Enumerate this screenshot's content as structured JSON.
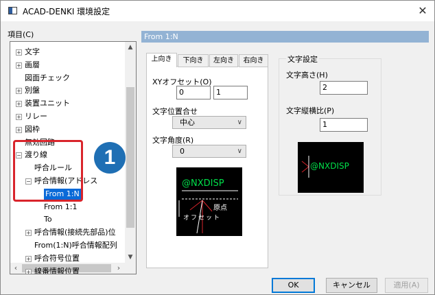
{
  "window": {
    "title": "ACAD-DENKI 環境設定",
    "close_glyph": "✕"
  },
  "items_label": "項目(C)",
  "tree": [
    {
      "label": "文字",
      "toggle": "+"
    },
    {
      "label": "画層",
      "toggle": "+"
    },
    {
      "label": "図面チェック",
      "toggle": ""
    },
    {
      "label": "別盤",
      "toggle": "+"
    },
    {
      "label": "装置ユニット",
      "toggle": "+"
    },
    {
      "label": "リレー",
      "toggle": "+"
    },
    {
      "label": "図枠",
      "toggle": "+"
    },
    {
      "label": "無効回路",
      "toggle": ""
    },
    {
      "label": "渡り線",
      "toggle": "−"
    },
    {
      "label": "呼合ルール",
      "toggle": ""
    },
    {
      "label": "呼合情報(アドレス",
      "toggle": "−"
    },
    {
      "label": "From 1:N",
      "toggle": "",
      "selected": true
    },
    {
      "label": "From 1:1",
      "toggle": ""
    },
    {
      "label": "To",
      "toggle": ""
    },
    {
      "label": "呼合情報(接続先部品)位",
      "toggle": "+"
    },
    {
      "label": "From(1:N)呼合情報配列",
      "toggle": ""
    },
    {
      "label": "呼合符号位置",
      "toggle": "+"
    },
    {
      "label": "線番情報位置",
      "toggle": "+"
    }
  ],
  "annotation_number": "1",
  "section_header": "From 1:N",
  "tabs": [
    "上向き",
    "下向き",
    "左向き",
    "右向き"
  ],
  "direction_panel": {
    "xy_offset_label": "XYオフセット(O)",
    "xy_offset_x": "0",
    "xy_offset_y": "1",
    "text_align_label": "文字位置合せ",
    "text_align_value": "中心",
    "text_angle_label": "文字角度(R)",
    "text_angle_value": "0",
    "preview": {
      "text": "@NXDISP",
      "origin_label": "原点",
      "offset_label": "オフセット"
    }
  },
  "text_settings": {
    "group_label": "文字設定",
    "height_label": "文字高さ(H)",
    "height_value": "2",
    "ratio_label": "文字縦横比(P)",
    "ratio_value": "1",
    "preview_text": "@NXDISP"
  },
  "buttons": {
    "ok": "OK",
    "cancel": "キャンセル",
    "apply": "適用(A)"
  },
  "colors": {
    "selection": "#0a6ad8",
    "header_bar": "#93b3d4",
    "annotation": "#d9242b",
    "badge": "#1f6fb4",
    "preview_text": "#00e04a"
  }
}
